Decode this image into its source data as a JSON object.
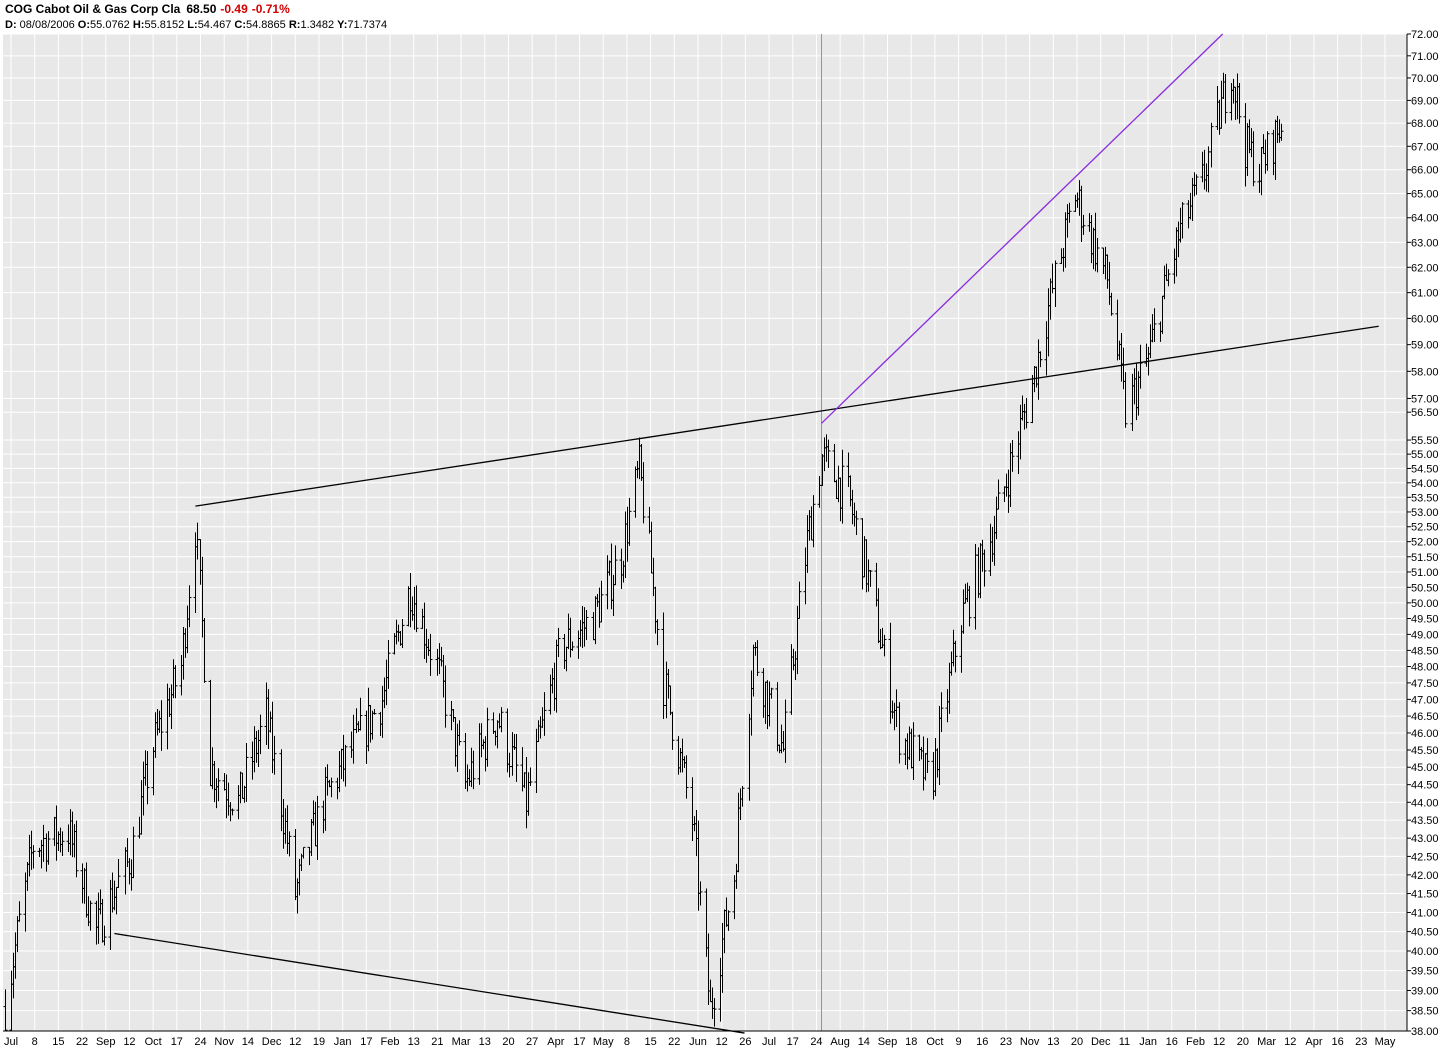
{
  "header": {
    "symbol_name": "COG Cabot Oil & Gas Corp Cla",
    "last": "68.50",
    "change": "-0.49",
    "change_pct": "-0.71%",
    "ohlc_line": {
      "d_label": "D:",
      "d_value": "08/08/2006",
      "o_label": "O:",
      "o_value": "55.0762",
      "h_label": "H:",
      "h_value": "55.8152",
      "l_label": "L:",
      "l_value": "54.467",
      "c_label": "C:",
      "c_value": "54.8865",
      "r_label": "R:",
      "r_value": "1.3482",
      "y_label": "Y:",
      "y_value": "71.7374"
    }
  },
  "colors": {
    "plot_bg": "#e8e8e8",
    "grid": "#ffffff",
    "bars": "#000000",
    "trendline": "#000000",
    "purple_trendline": "#8a2be2",
    "cursor": "#7f9f9f",
    "change": "#d00000"
  },
  "chart_data": {
    "type": "ohlc-bar",
    "y_scale": "log",
    "ylim": [
      38.0,
      72.0
    ],
    "y_ticks": [
      "38.00",
      "38.50",
      "39.00",
      "39.50",
      "40.00",
      "40.50",
      "41.00",
      "41.50",
      "42.00",
      "42.50",
      "43.00",
      "43.50",
      "44.00",
      "44.50",
      "45.00",
      "45.50",
      "46.00",
      "46.50",
      "47.00",
      "47.50",
      "48.00",
      "48.50",
      "49.00",
      "49.50",
      "50.00",
      "50.50",
      "51.00",
      "51.50",
      "52.00",
      "52.50",
      "53.00",
      "53.50",
      "54.00",
      "54.50",
      "55.00",
      "55.50",
      "56.50",
      "57.00",
      "58.00",
      "59.00",
      "60.00",
      "61.00",
      "62.00",
      "63.00",
      "64.00",
      "65.00",
      "66.00",
      "67.00",
      "68.00",
      "69.00",
      "70.00",
      "71.00",
      "72.00"
    ],
    "x_ticks": [
      "Jul",
      "8",
      "15",
      "22",
      "Sep",
      "12",
      "Oct",
      "17",
      "24",
      "Nov",
      "14",
      "Dec",
      "12",
      "19",
      "Jan",
      "17",
      "Feb",
      "13",
      "21",
      "Mar",
      "13",
      "20",
      "27",
      "Apr",
      "17",
      "May",
      "8",
      "15",
      "22",
      "Jun",
      "12",
      "26",
      "Jul",
      "17",
      "24",
      "Aug",
      "14",
      "Sep",
      "18",
      "Oct",
      "9",
      "16",
      "23",
      "Nov",
      "13",
      "20",
      "Dec",
      "11",
      "Jan",
      "16",
      "Feb",
      "12",
      "20",
      "Mar",
      "12",
      "Apr",
      "16",
      "23",
      "May"
    ],
    "x_start": "2005-07-01",
    "cursor_date": "2006-08-08",
    "series_closes": [
      {
        "date": "2005-07-01",
        "close": 38.6
      },
      {
        "date": "2005-07-15",
        "close": 42.8
      },
      {
        "date": "2005-08-01",
        "close": 43.2
      },
      {
        "date": "2005-08-15",
        "close": 40.5
      },
      {
        "date": "2005-09-01",
        "close": 42.5
      },
      {
        "date": "2005-09-12",
        "close": 45.6
      },
      {
        "date": "2005-09-26",
        "close": 48.0
      },
      {
        "date": "2005-10-03",
        "close": 52.5
      },
      {
        "date": "2005-10-10",
        "close": 45.0
      },
      {
        "date": "2005-10-24",
        "close": 44.0
      },
      {
        "date": "2005-11-07",
        "close": 46.5
      },
      {
        "date": "2005-11-21",
        "close": 41.5
      },
      {
        "date": "2005-12-05",
        "close": 44.0
      },
      {
        "date": "2005-12-19",
        "close": 45.5
      },
      {
        "date": "2006-01-03",
        "close": 47.0
      },
      {
        "date": "2006-01-17",
        "close": 50.5
      },
      {
        "date": "2006-01-30",
        "close": 48.0
      },
      {
        "date": "2006-02-13",
        "close": 44.5
      },
      {
        "date": "2006-03-01",
        "close": 46.5
      },
      {
        "date": "2006-03-15",
        "close": 44.0
      },
      {
        "date": "2006-04-01",
        "close": 48.5
      },
      {
        "date": "2006-04-17",
        "close": 49.5
      },
      {
        "date": "2006-05-01",
        "close": 51.5
      },
      {
        "date": "2006-05-10",
        "close": 54.5
      },
      {
        "date": "2006-05-22",
        "close": 47.5
      },
      {
        "date": "2006-06-05",
        "close": 43.5
      },
      {
        "date": "2006-06-14",
        "close": 38.5
      },
      {
        "date": "2006-06-26",
        "close": 42.0
      },
      {
        "date": "2006-07-05",
        "close": 48.5
      },
      {
        "date": "2006-07-20",
        "close": 45.5
      },
      {
        "date": "2006-08-01",
        "close": 52.0
      },
      {
        "date": "2006-08-08",
        "close": 54.8865
      },
      {
        "date": "2006-08-21",
        "close": 53.5
      },
      {
        "date": "2006-09-01",
        "close": 50.5
      },
      {
        "date": "2006-09-15",
        "close": 46.0
      },
      {
        "date": "2006-10-01",
        "close": 44.5
      },
      {
        "date": "2006-10-16",
        "close": 49.5
      },
      {
        "date": "2006-11-01",
        "close": 52.5
      },
      {
        "date": "2006-11-20",
        "close": 57.5
      },
      {
        "date": "2006-12-01",
        "close": 61.5
      },
      {
        "date": "2006-12-11",
        "close": 65.0
      },
      {
        "date": "2006-12-27",
        "close": 61.5
      },
      {
        "date": "2007-01-05",
        "close": 56.5
      },
      {
        "date": "2007-01-16",
        "close": 58.5
      },
      {
        "date": "2007-02-01",
        "close": 63.5
      },
      {
        "date": "2007-02-12",
        "close": 65.5
      },
      {
        "date": "2007-02-26",
        "close": 70.5
      },
      {
        "date": "2007-03-05",
        "close": 67.0
      },
      {
        "date": "2007-03-12",
        "close": 66.0
      },
      {
        "date": "2007-03-26",
        "close": 68.5
      }
    ],
    "trendlines": [
      {
        "name": "upper",
        "points": [
          {
            "date": "2005-10-03",
            "price": 53.2
          },
          {
            "date": "2007-05-10",
            "price": 59.7
          }
        ]
      },
      {
        "name": "lower",
        "points": [
          {
            "date": "2005-08-24",
            "price": 40.45
          },
          {
            "date": "2006-07-01",
            "price": 37.95
          }
        ]
      },
      {
        "name": "purple",
        "points": [
          {
            "date": "2006-08-08",
            "price": 56.1
          },
          {
            "date": "2007-02-22",
            "price": 72.0
          }
        ]
      }
    ]
  }
}
